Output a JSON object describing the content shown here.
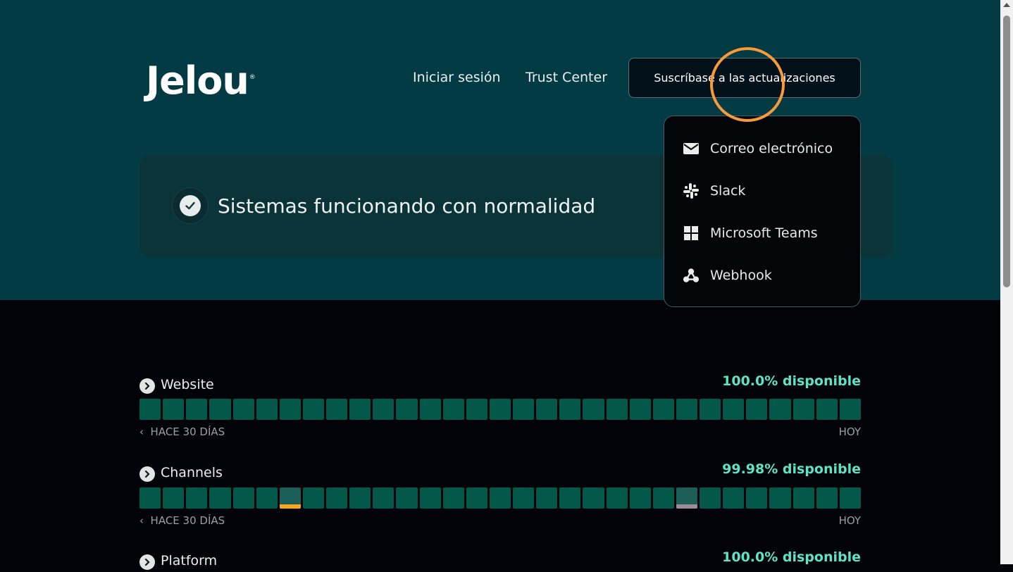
{
  "brand": {
    "logo_text": "Jelou",
    "registered": "®"
  },
  "nav": {
    "login": "Iniciar sesión",
    "trust": "Trust Center",
    "subscribe": "Suscríbase a las actualizaciones"
  },
  "status": {
    "title": "Sistemas funcionando con normalidad"
  },
  "dropdown": {
    "items": [
      {
        "label": "Correo electrónico",
        "icon": "mail-icon"
      },
      {
        "label": "Slack",
        "icon": "slack-icon"
      },
      {
        "label": "Microsoft Teams",
        "icon": "teams-icon"
      },
      {
        "label": "Webhook",
        "icon": "webhook-icon"
      }
    ]
  },
  "components": [
    {
      "name": "Website",
      "uptime": "100.0% disponible",
      "range_start": "HACE 30 DÍAS",
      "range_end": "HOY",
      "incidents": []
    },
    {
      "name": "Channels",
      "uptime": "99.98% disponible",
      "range_start": "HACE 30 DÍAS",
      "range_end": "HOY",
      "incidents": [
        {
          "day": 7,
          "color": "#f5a623"
        },
        {
          "day": 24,
          "color": "#9c8c98"
        }
      ]
    },
    {
      "name": "Platform",
      "uptime": "100.0% disponible"
    }
  ],
  "colors": {
    "hero": "#033b45",
    "bar_ok": "#03584a",
    "uptime_text": "#5fe3c5",
    "accent_ring": "#f79a3a"
  }
}
